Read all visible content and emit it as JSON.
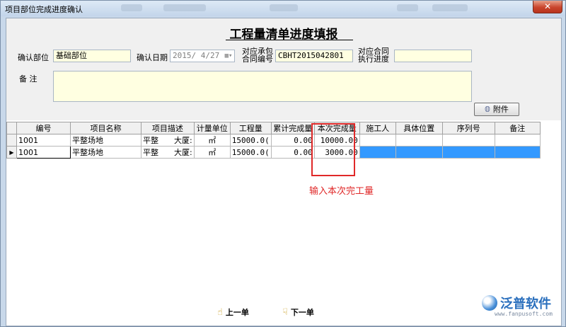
{
  "window": {
    "title": "项目部位完成进度确认",
    "close_label": "✕"
  },
  "form": {
    "title": "工程量清单进度填报",
    "confirm_dept_label": "确认部位",
    "confirm_dept_value": "基础部位",
    "confirm_date_label": "确认日期",
    "confirm_date_value": "2015/ 4/27",
    "contract_no_label_line1": "对应承包",
    "contract_no_label_line2": "合同编号",
    "contract_no_value": "CBHT2015042801",
    "exec_progress_label_line1": "对应合同",
    "exec_progress_label_line2": "执行进度",
    "exec_progress_value": "",
    "remark_label": "备    注",
    "remark_value": "",
    "attach_button": "附件",
    "attach_icon": "paperclip-icon"
  },
  "grid": {
    "columns": [
      "编号",
      "项目名称",
      "项目描述",
      "计量单位",
      "工程量",
      "累计完成量",
      "本次完成量",
      "施工人",
      "具体位置",
      "序列号",
      "备注"
    ],
    "rows": [
      {
        "code": "1001",
        "name": "平整场地",
        "desc_a": "平整",
        "desc_b": "大厦:",
        "unit": "㎡",
        "qty": "15000.0(",
        "cumulative": "0.00",
        "current": "10000.00",
        "worker": "",
        "location": "",
        "serial": "",
        "remark": ""
      },
      {
        "code": "1001",
        "name": "平整场地",
        "desc_a": "平整",
        "desc_b": "大厦:",
        "unit": "㎡",
        "qty": "15000.0(",
        "cumulative": "0.00",
        "current": "3000.00",
        "worker": "",
        "location": "",
        "serial": "",
        "remark": ""
      }
    ],
    "current_row_marker": "▶"
  },
  "annotation": "输入本次完工量",
  "footer": {
    "prev_button": "上一单",
    "next_button": "下一单",
    "prev_icon": "pointing-hand-icon",
    "next_icon": "pointing-hand-icon"
  },
  "logo": {
    "name": "泛普软件",
    "site": "www.fanpusoft.com"
  },
  "colors": {
    "selection": "#3399ff",
    "highlight": "#e02828",
    "field_bg": "#ffffe1"
  }
}
